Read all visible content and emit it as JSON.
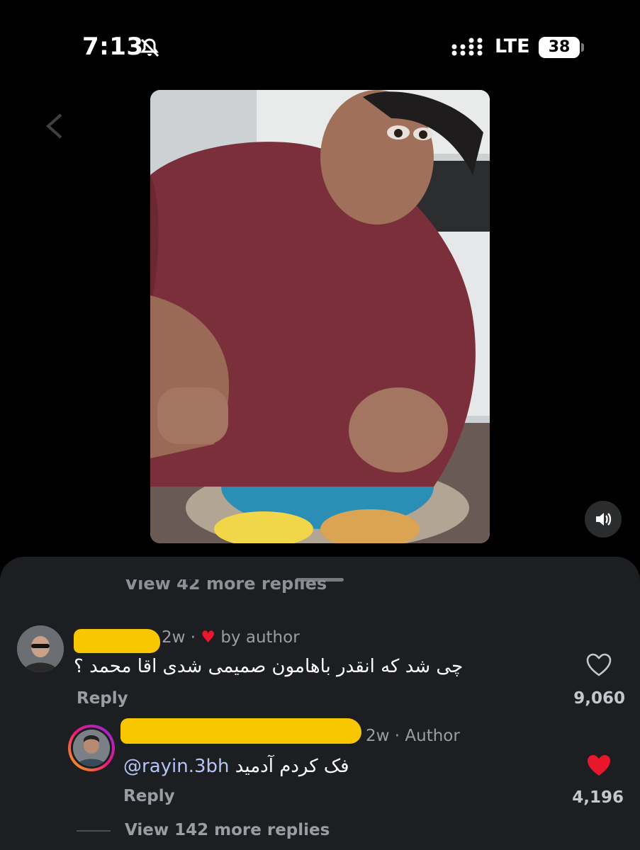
{
  "status": {
    "time": "7:13",
    "network": "LTE",
    "battery": "38"
  },
  "video": {
    "description_icon": "video-frame",
    "sound": "speaker-icon"
  },
  "comments": {
    "cut_replies_label": "View 42 more replies",
    "first": {
      "age": "2w",
      "liked_by": "by author",
      "text": "چی شد که انقدر باهامون صمیمی شدی اقا محمد ؟",
      "reply_label": "Reply",
      "likes": "9,060"
    },
    "second": {
      "age": "2w",
      "role": "Author",
      "mention": "@rayin.3bh",
      "text": "فک کردم آدمید",
      "reply_label": "Reply",
      "likes": "4,196"
    },
    "more_replies_label": "View 142 more replies"
  },
  "colors": {
    "heart": "#e8172b",
    "redaction": "#f7c802",
    "sheet": "#1c1e21"
  }
}
